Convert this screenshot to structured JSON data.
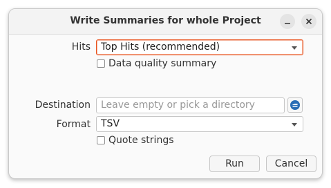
{
  "window": {
    "title": "Write Summaries for whole Project",
    "minimize_icon": "minimize-icon",
    "close_icon": "close-icon"
  },
  "form": {
    "hits_label": "Hits",
    "hits_value": "Top Hits (recommended)",
    "data_quality_label": "Data quality summary",
    "data_quality_checked": false,
    "destination_label": "Destination",
    "destination_value": "",
    "destination_placeholder": "Leave empty or pick a directory",
    "destination_picker_icon": "folder-picker-icon",
    "format_label": "Format",
    "format_value": "TSV",
    "quote_strings_label": "Quote strings",
    "quote_strings_checked": false
  },
  "actions": {
    "run_label": "Run",
    "cancel_label": "Cancel"
  },
  "colors": {
    "focus_accent": "#e95420",
    "picker_icon_blue": "#2a6db5"
  }
}
